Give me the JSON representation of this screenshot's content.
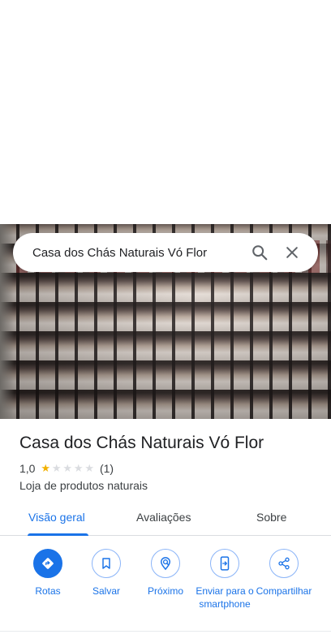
{
  "search": {
    "query": "Casa dos Chás Naturais Vó Flor"
  },
  "place": {
    "name": "Casa dos Chás Naturais Vó Flor",
    "rating": "1,0",
    "rating_value": 1.0,
    "review_count": "(1)",
    "category": "Loja de produtos naturais"
  },
  "tabs": [
    {
      "label": "Visão geral",
      "active": true
    },
    {
      "label": "Avaliações",
      "active": false
    },
    {
      "label": "Sobre",
      "active": false
    }
  ],
  "actions": [
    {
      "label": "Rotas",
      "icon": "directions-icon"
    },
    {
      "label": "Salvar",
      "icon": "bookmark-icon"
    },
    {
      "label": "Próximo",
      "icon": "nearby-icon"
    },
    {
      "label": "Enviar para o smartphone",
      "icon": "send-to-phone-icon"
    },
    {
      "label": "Compartilhar",
      "icon": "share-icon"
    }
  ],
  "colors": {
    "accent": "#1a73e8",
    "star": "#f2b100",
    "text": "#202124"
  }
}
